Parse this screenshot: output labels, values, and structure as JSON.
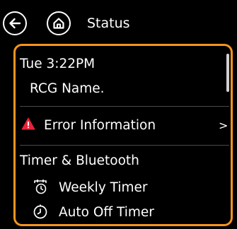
{
  "header": {
    "title": "Status"
  },
  "status": {
    "datetime": "Tue  3:22PM",
    "name": "RCG Name.",
    "error_label": "Error Information",
    "error_chevron": ">",
    "section_title": "Timer & Bluetooth",
    "weekly_timer_label": "Weekly Timer",
    "auto_off_timer_label": "Auto Off Timer"
  },
  "colors": {
    "accent": "#f7941d",
    "warning": "#e8233a",
    "background": "#000000",
    "text": "#ffffff",
    "divider": "#4a4a4a"
  }
}
